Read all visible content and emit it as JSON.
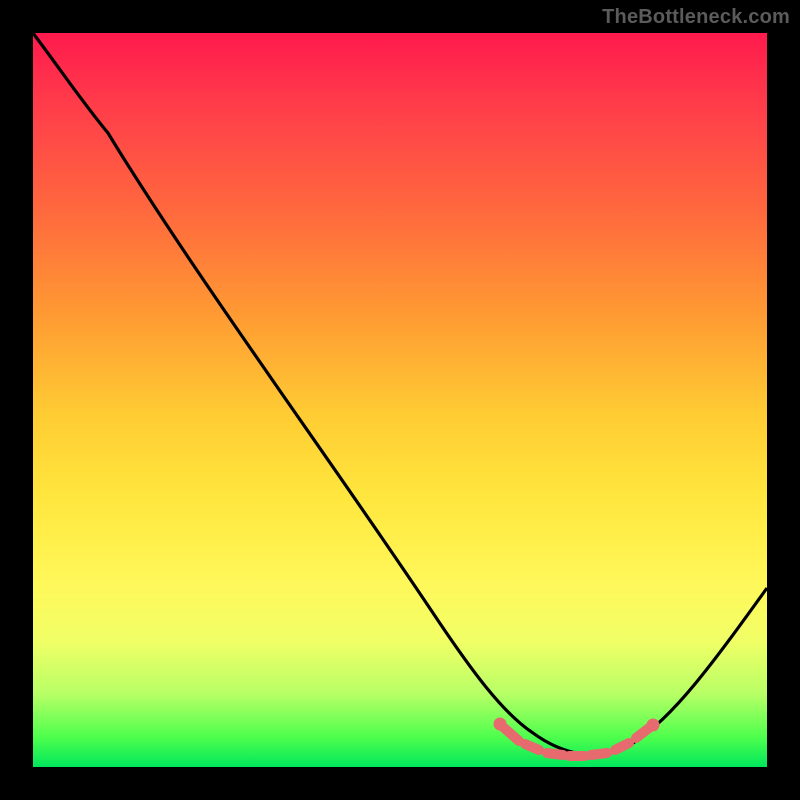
{
  "watermark": "TheBottleneck.com",
  "chart_data": {
    "type": "line",
    "title": "",
    "xlabel": "",
    "ylabel": "",
    "xlim": [
      0,
      100
    ],
    "ylim": [
      0,
      100
    ],
    "series": [
      {
        "name": "curve",
        "x": [
          0,
          5,
          10,
          20,
          30,
          40,
          50,
          55,
          60,
          65,
          68,
          70,
          72,
          74,
          76,
          78,
          80,
          82,
          85,
          90,
          95,
          100
        ],
        "y": [
          100,
          94,
          88,
          75,
          62,
          49,
          34,
          26,
          18,
          10,
          6,
          4,
          3,
          2.5,
          2,
          2,
          2.5,
          3,
          5,
          12,
          22,
          34
        ]
      }
    ],
    "markers": {
      "name": "highlight-band",
      "x": [
        66,
        69,
        71,
        73,
        75,
        77,
        79,
        81,
        83
      ],
      "y": [
        5.5,
        3.8,
        3.0,
        2.6,
        2.3,
        2.2,
        2.4,
        3.0,
        4.0
      ]
    },
    "gradient_stops": [
      {
        "pos": 0,
        "color": "#ff1a4d"
      },
      {
        "pos": 10,
        "color": "#ff3d4a"
      },
      {
        "pos": 25,
        "color": "#ff6b3d"
      },
      {
        "pos": 38,
        "color": "#ff9933"
      },
      {
        "pos": 52,
        "color": "#ffcc33"
      },
      {
        "pos": 63,
        "color": "#ffe63d"
      },
      {
        "pos": 75,
        "color": "#fff85a"
      },
      {
        "pos": 83,
        "color": "#f0ff66"
      },
      {
        "pos": 90,
        "color": "#b8ff66"
      },
      {
        "pos": 96,
        "color": "#4dff4d"
      },
      {
        "pos": 100,
        "color": "#00e65c"
      }
    ]
  }
}
